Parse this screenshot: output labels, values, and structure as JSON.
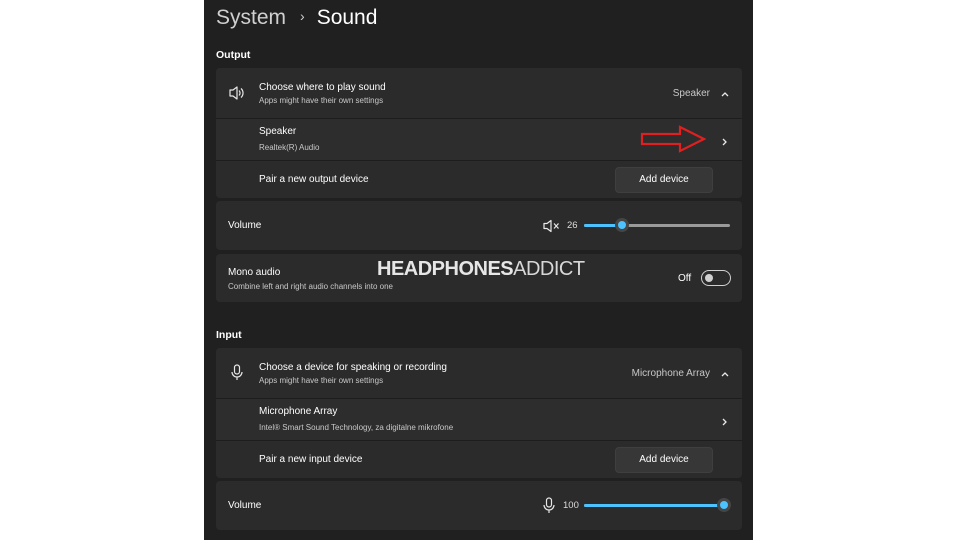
{
  "header": {
    "breadcrumb_parent": "System",
    "separator": "›",
    "title": "Sound"
  },
  "output": {
    "section_label": "Output",
    "choose": {
      "icon": "speaker-icon",
      "title": "Choose where to play sound",
      "subtitle": "Apps might have their own settings",
      "selected": "Speaker",
      "expand_icon": "chevron-up-icon"
    },
    "device": {
      "name": "Speaker",
      "detail": "Realtek(R) Audio",
      "nav_icon": "chevron-right-icon",
      "annotation_icon": "red-arrow-icon",
      "annotation_color": "#e02020"
    },
    "pair": {
      "label": "Pair a new output device",
      "button": "Add device"
    },
    "volume": {
      "label": "Volume",
      "icon": "speaker-muted-icon",
      "value": "26",
      "percent": 26
    },
    "mono": {
      "title": "Mono audio",
      "subtitle": "Combine left and right audio channels into one",
      "state": "Off",
      "on": false
    }
  },
  "input": {
    "section_label": "Input",
    "choose": {
      "icon": "microphone-icon",
      "title": "Choose a device for speaking or recording",
      "subtitle": "Apps might have their own settings",
      "selected": "Microphone Array",
      "expand_icon": "chevron-up-icon"
    },
    "device": {
      "name": "Microphone Array",
      "detail": "Intel® Smart Sound Technology, za digitalne mikrofone",
      "nav_icon": "chevron-right-icon"
    },
    "pair": {
      "label": "Pair a new input device",
      "button": "Add device"
    },
    "volume": {
      "label": "Volume",
      "icon": "microphone-icon",
      "value": "100",
      "percent": 100
    }
  },
  "watermark": {
    "bold": "HEADPHONES",
    "thin": "ADDICT"
  },
  "colors": {
    "accent": "#4cc2ff",
    "background": "#202020",
    "card": "#2b2b2b"
  }
}
